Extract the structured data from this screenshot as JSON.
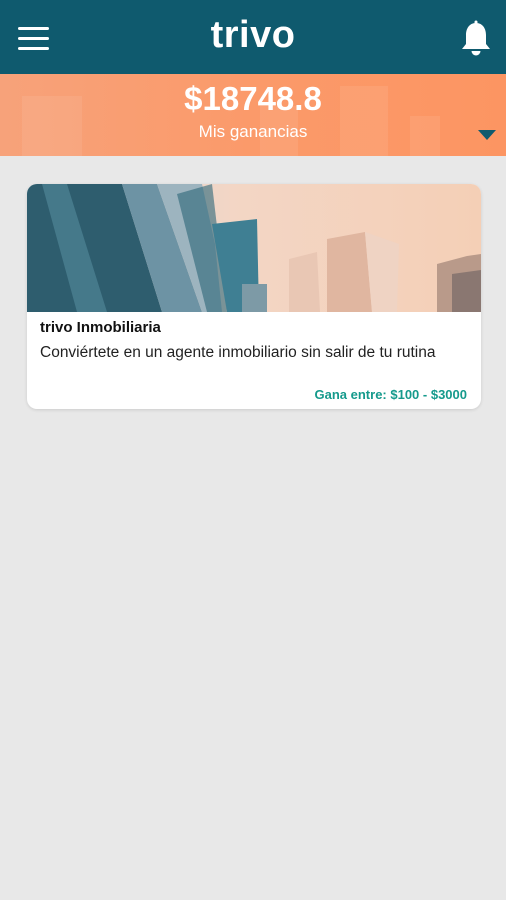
{
  "header": {
    "brand": "trivo",
    "menu_icon": "hamburger-menu-icon",
    "bell_icon": "bell-icon"
  },
  "earnings": {
    "amount": "$18748.8",
    "label": "Mis ganancias",
    "dropdown_icon": "caret-down-icon"
  },
  "cards": [
    {
      "title": "trivo Inmobiliaria",
      "description": "Conviértete en un agente inmobiliario sin salir de tu rutina",
      "earn": "Gana entre: $100 - $3000",
      "image": "city-skyscrapers-image"
    }
  ],
  "colors": {
    "header_bg": "#0f5a6e",
    "banner_bg": "#fb9a6a",
    "page_bg": "#e8e8e8",
    "accent_green": "#159a8c"
  }
}
